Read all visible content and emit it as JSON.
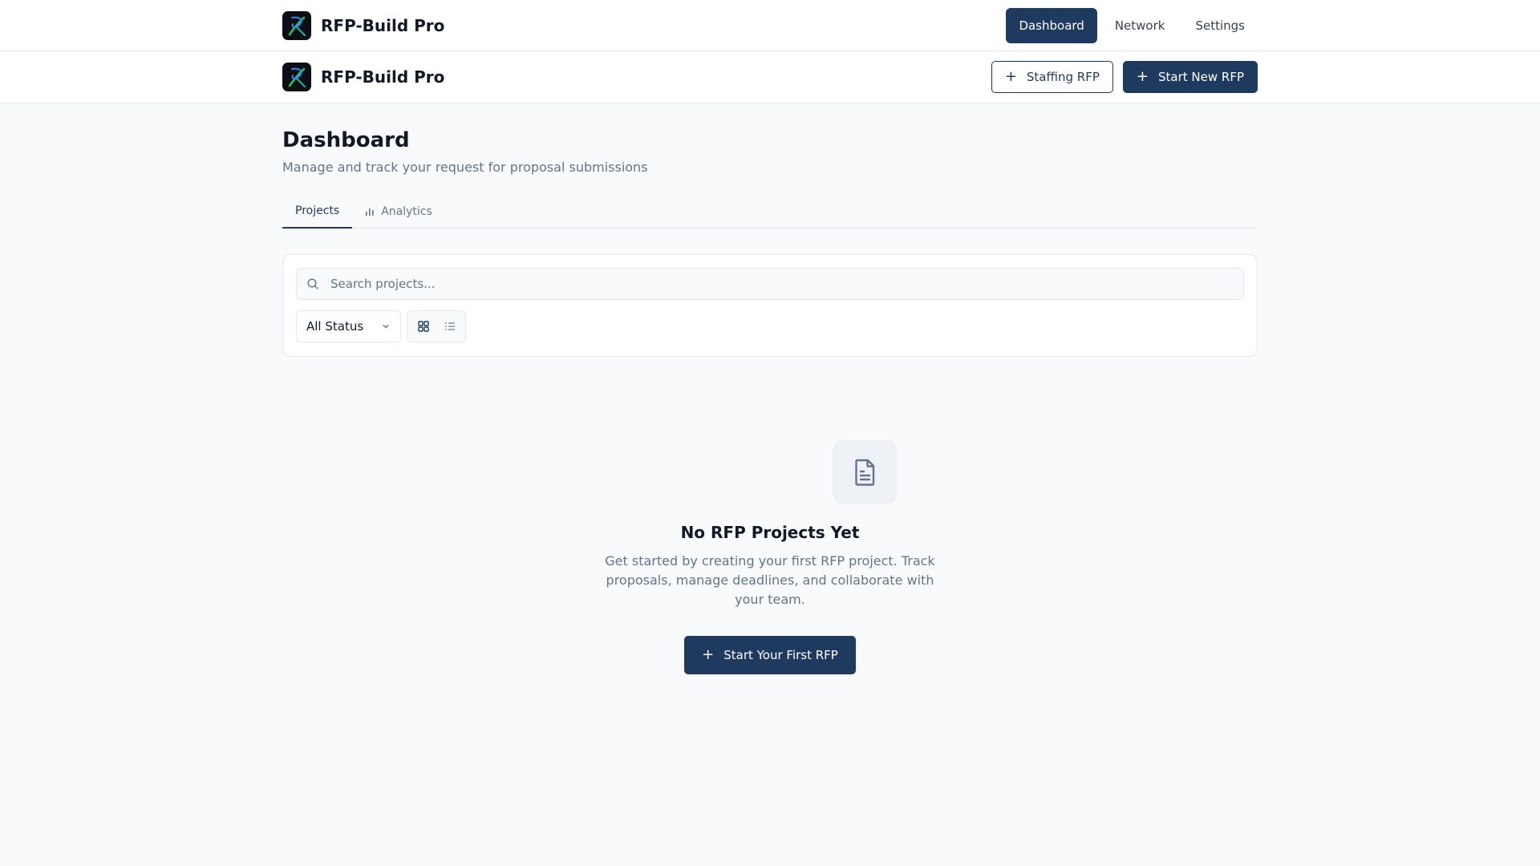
{
  "app": {
    "name": "RFP-Build Pro"
  },
  "topnav": {
    "items": [
      {
        "label": "Dashboard",
        "active": true
      },
      {
        "label": "Network",
        "active": false
      },
      {
        "label": "Settings",
        "active": false
      }
    ]
  },
  "subheader": {
    "staffing_label": "Staffing RFP",
    "new_label": "Start New RFP"
  },
  "page": {
    "title": "Dashboard",
    "subtitle": "Manage and track your request for proposal submissions"
  },
  "tabs": [
    {
      "label": "Projects",
      "active": true
    },
    {
      "label": "Analytics",
      "active": false,
      "icon": "bar-chart-icon"
    }
  ],
  "filters": {
    "search_placeholder": "Search projects...",
    "status_value": "All Status",
    "view_modes": [
      "grid-icon",
      "list-icon"
    ]
  },
  "empty_state": {
    "icon": "document-icon",
    "title": "No RFP Projects Yet",
    "description": "Get started by creating your first RFP project. Track proposals, manage deadlines, and collaborate with your team.",
    "button_label": "Start Your First RFP"
  },
  "colors": {
    "primary": "#1e3a5f",
    "background": "#f8fafc",
    "muted_text": "#64748b",
    "border": "#e2e8f0"
  }
}
